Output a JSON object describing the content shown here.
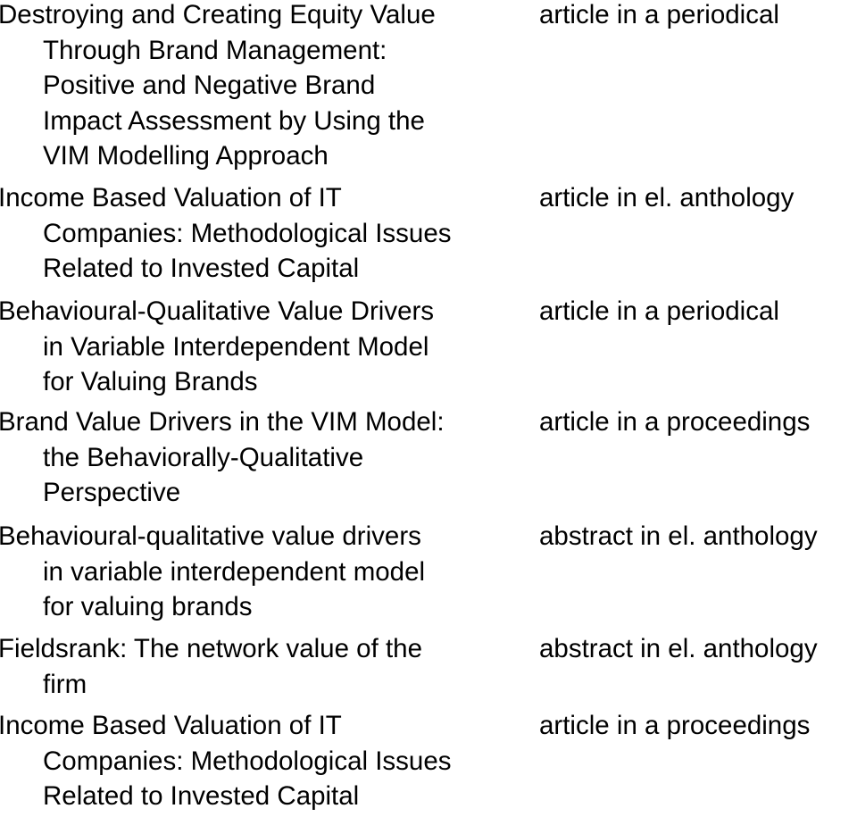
{
  "entries": [
    {
      "title_lines": [
        "Destroying and Creating Equity Value",
        "Through Brand Management:",
        "Positive and Negative Brand",
        "Impact Assessment by Using the",
        "VIM Modelling Approach"
      ],
      "type": "article in a periodical"
    },
    {
      "title_lines": [
        "Income Based Valuation of IT",
        "Companies: Methodological Issues",
        "Related to Invested Capital"
      ],
      "type": "article in el. anthology"
    },
    {
      "title_lines": [
        "Behavioural-Qualitative Value Drivers",
        "in Variable Interdependent Model",
        "for Valuing Brands"
      ],
      "type": "article in a periodical"
    },
    {
      "title_lines": [
        "Brand Value Drivers in the VIM Model:",
        "the Behaviorally-Qualitative",
        "Perspective"
      ],
      "type": "article in a proceedings"
    },
    {
      "title_lines": [
        "Behavioural-qualitative value drivers",
        "in variable interdependent model",
        "for valuing brands"
      ],
      "type": "abstract in el. anthology"
    },
    {
      "title_lines": [
        "Fieldsrank: The network value of the",
        "firm"
      ],
      "type": "abstract in el. anthology"
    },
    {
      "title_lines": [
        "Income Based Valuation of IT",
        "Companies: Methodological Issues",
        "Related to Invested Capital"
      ],
      "type": "article in a proceedings"
    }
  ]
}
